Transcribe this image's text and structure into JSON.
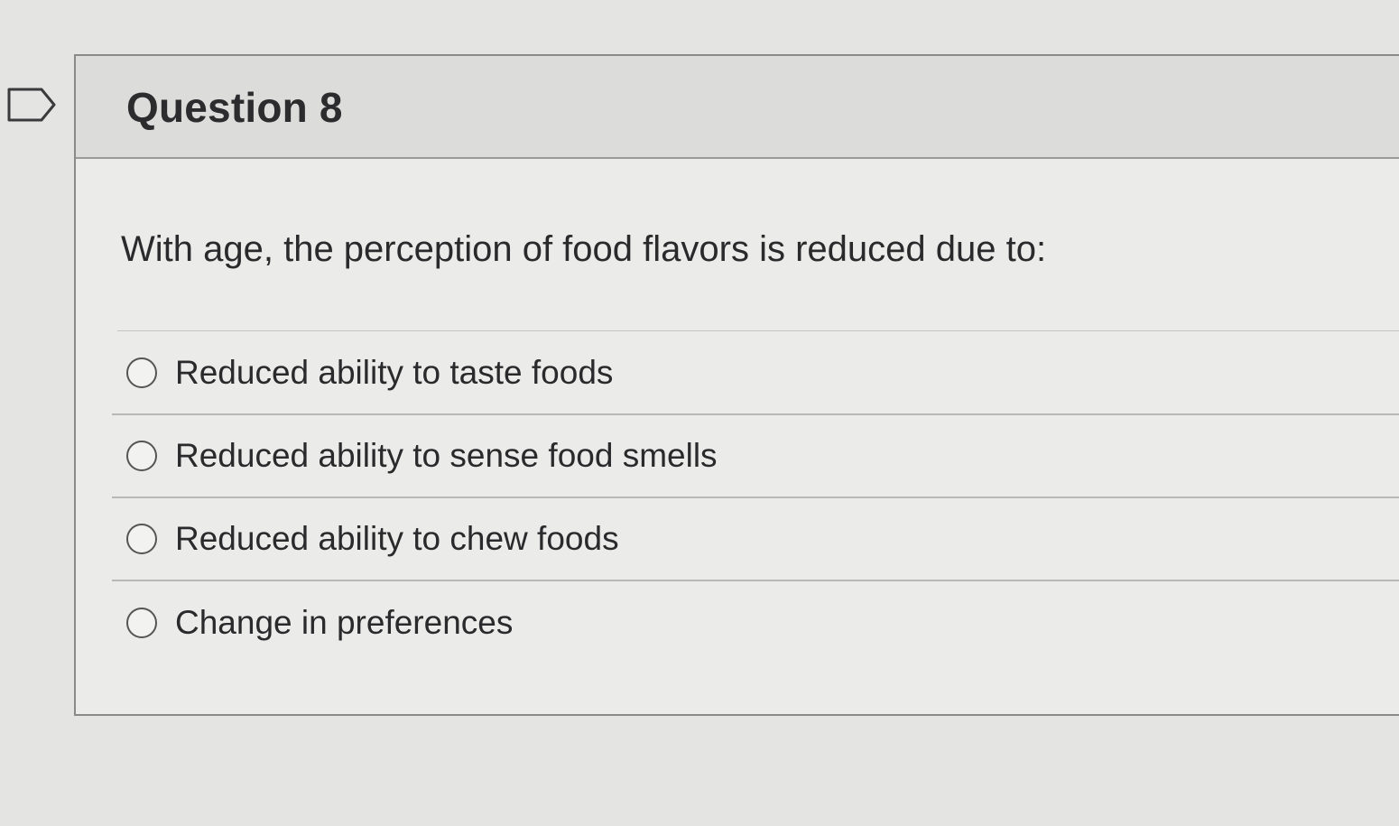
{
  "question": {
    "title": "Question 8",
    "prompt": "With age, the perception of food flavors is reduced due to:",
    "flag_icon": "flag-outline-icon",
    "answers": [
      {
        "label": "Reduced ability to taste foods",
        "selected": false
      },
      {
        "label": "Reduced ability to sense food smells",
        "selected": false
      },
      {
        "label": "Reduced ability to chew foods",
        "selected": false
      },
      {
        "label": "Change in preferences",
        "selected": false
      }
    ]
  },
  "colors": {
    "background": "#e4e4e2",
    "header": "#dcdcdb",
    "border": "#8a8a8a",
    "text": "#2a2a2c"
  }
}
